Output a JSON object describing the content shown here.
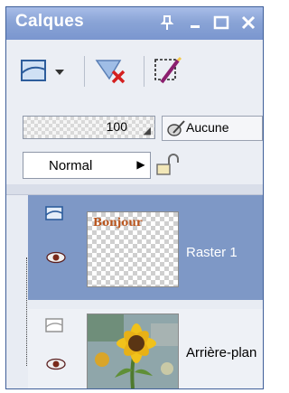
{
  "window": {
    "title": "Calques",
    "buttons": [
      "pin-icon",
      "minimize-icon",
      "maximize-icon",
      "close-icon"
    ]
  },
  "toolbar": {
    "items": [
      "new-layer-icon",
      "dropdown-arrow-icon",
      "delete-layer-icon",
      "edit-selection-icon"
    ]
  },
  "properties": {
    "opacity": "100",
    "mask": "Aucune",
    "blend_mode": "Normal"
  },
  "layers": [
    {
      "name": "Raster 1",
      "selected": true,
      "thumb_text": "Bonjour"
    },
    {
      "name": "Arrière-plan",
      "selected": false
    }
  ],
  "colors": {
    "titlebar": "#8aa4d6",
    "selected_row": "#7e98c6",
    "panel": "#ebeef4"
  }
}
